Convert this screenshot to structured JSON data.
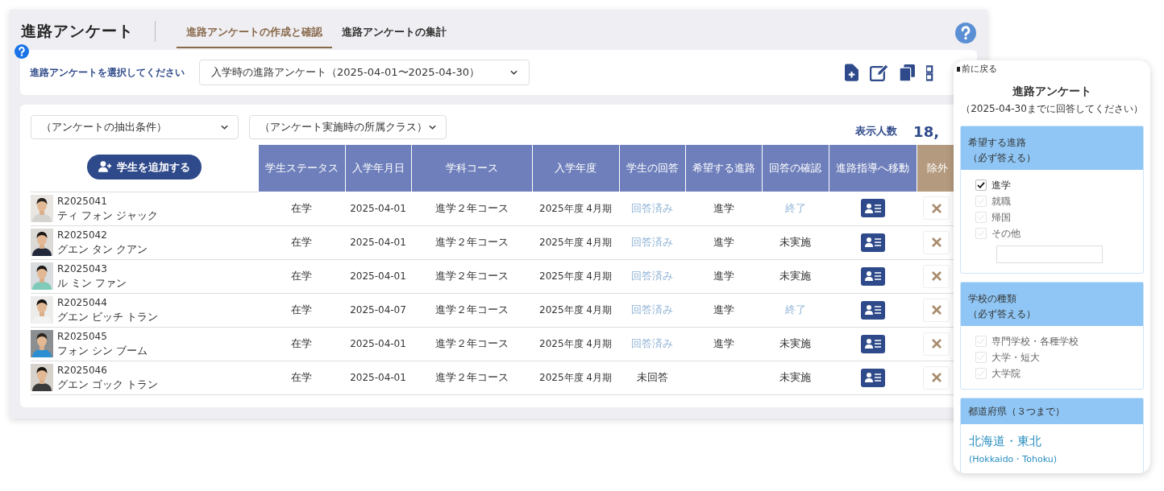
{
  "app_title": "進路アンケート",
  "tabs": [
    {
      "label": "進路アンケートの作成と確認",
      "selected": true
    },
    {
      "label": "進路アンケートの集計",
      "selected": false
    }
  ],
  "survey_select": {
    "label": "進路アンケートを選択してください",
    "value": "入学時の進路アンケート（2025-04-01〜2025-04-30）"
  },
  "filters": [
    {
      "value": "（アンケートの抽出条件）"
    },
    {
      "value": "（アンケート実施時の所属クラス）"
    }
  ],
  "count_label": "表示人数",
  "count_value": "18,",
  "add_button": "学生を追加する",
  "columns": [
    "学生ステータス",
    "入学年月日",
    "学科コース",
    "入学年度",
    "学生の回答",
    "希望する進路",
    "回答の確認",
    "進路指導へ移動",
    "除外"
  ],
  "rows": [
    {
      "id": "R2025041",
      "name": "ティ フォン ジャック",
      "status": "在学",
      "date": "2025-04-01",
      "course": "進学２年コース",
      "year": "2025年度 4月期",
      "answer": {
        "text": "回答済み",
        "kind": "done"
      },
      "path": "進学",
      "confirm": {
        "text": "終了",
        "kind": "done"
      }
    },
    {
      "id": "R2025042",
      "name": "グエン タン クアン",
      "status": "在学",
      "date": "2025-04-01",
      "course": "進学２年コース",
      "year": "2025年度 4月期",
      "answer": {
        "text": "回答済み",
        "kind": "done"
      },
      "path": "進学",
      "confirm": {
        "text": "未実施",
        "kind": "none"
      }
    },
    {
      "id": "R2025043",
      "name": "ル ミン ファン",
      "status": "在学",
      "date": "2025-04-01",
      "course": "進学２年コース",
      "year": "2025年度 4月期",
      "answer": {
        "text": "回答済み",
        "kind": "done"
      },
      "path": "進学",
      "confirm": {
        "text": "未実施",
        "kind": "none"
      }
    },
    {
      "id": "R2025044",
      "name": "グエン ビッチ トラン",
      "status": "在学",
      "date": "2025-04-07",
      "course": "進学２年コース",
      "year": "2025年度 4月期",
      "answer": {
        "text": "回答済み",
        "kind": "done"
      },
      "path": "進学",
      "confirm": {
        "text": "終了",
        "kind": "done"
      }
    },
    {
      "id": "R2025045",
      "name": "フォン シン ブーム",
      "status": "在学",
      "date": "2025-04-01",
      "course": "進学２年コース",
      "year": "2025年度 4月期",
      "answer": {
        "text": "回答済み",
        "kind": "done"
      },
      "path": "進学",
      "confirm": {
        "text": "未実施",
        "kind": "none"
      }
    },
    {
      "id": "R2025046",
      "name": "グエン ゴック トラン",
      "status": "在学",
      "date": "2025-04-01",
      "course": "進学２年コース",
      "year": "2025年度 4月期",
      "answer": {
        "text": "未回答",
        "kind": "none"
      },
      "confirm": {
        "text": "未実施",
        "kind": "none"
      }
    }
  ],
  "preview": {
    "back": "前に戻る",
    "title": "進路アンケート",
    "subtitle": "（2025-04-30までに回答してください）",
    "sections": [
      {
        "title": "希望する進路",
        "note": "（必ず答える）",
        "options": [
          {
            "label": "進学",
            "checked": true
          },
          {
            "label": "就職",
            "checked": false
          },
          {
            "label": "帰国",
            "checked": false
          },
          {
            "label": "その他",
            "checked": false
          }
        ],
        "other_field": true
      },
      {
        "title": "学校の種類",
        "note": "（必ず答える）",
        "options": [
          {
            "label": "専門学校・各種学校",
            "checked": false
          },
          {
            "label": "大学・短大",
            "checked": false
          },
          {
            "label": "大学院",
            "checked": false
          }
        ]
      },
      {
        "title": "都道府県（３つまで）",
        "region": "北海道・東北",
        "region_en": "(Hokkaido・Tohoku)"
      }
    ]
  }
}
